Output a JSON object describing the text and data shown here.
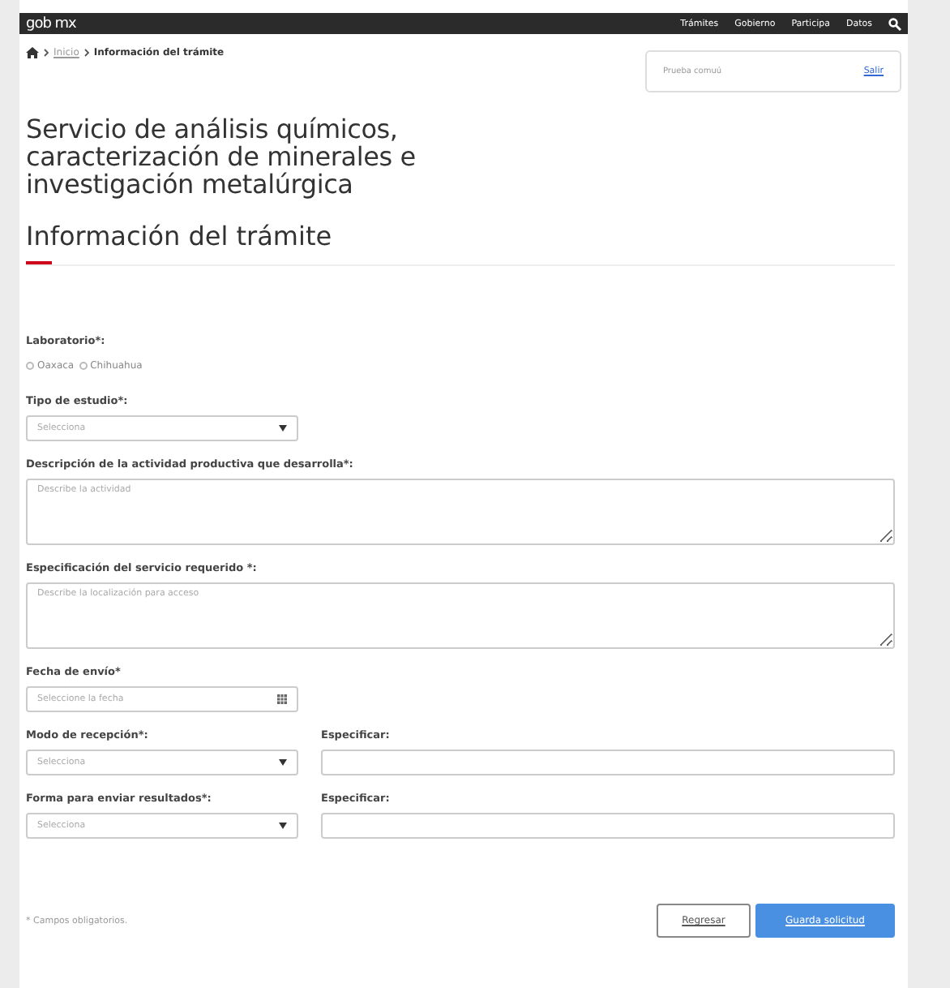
{
  "navbar": {
    "logo": "gob mx",
    "links": [
      "Trámites",
      "Gobierno",
      "Participa",
      "Datos"
    ]
  },
  "breadcrumb": {
    "items": [
      {
        "label": "Inicio",
        "kind": "link"
      },
      {
        "label": "Información del trámite",
        "kind": "current"
      }
    ]
  },
  "user_box": {
    "name": "Prueba comuú",
    "logout": "Salir"
  },
  "title": "Servicio de análisis químicos, caracterización de minerales e investigación metalúrgica",
  "section_title": "Información del trámite",
  "form": {
    "laboratorio": {
      "label": "Laboratorio*:",
      "options": [
        {
          "label": "Oaxaca",
          "selected": false
        },
        {
          "label": "Chihuahua",
          "selected": false
        }
      ]
    },
    "tipo": {
      "label": "Tipo de estudio*:",
      "placeholder": "Selecciona"
    },
    "descripcion": {
      "label": "Descripción de la actividad productiva que desarrolla*:",
      "placeholder": "Describe la actividad"
    },
    "especificacion": {
      "label": "Especificación del servicio requerido *:",
      "placeholder": "Describe la localización para acceso"
    },
    "fecha": {
      "label": "Fecha de envío*",
      "placeholder": "Seleccione la fecha"
    },
    "pairs": [
      {
        "label": "Modo de recepción*:",
        "placeholder": "Selecciona",
        "spec_label": "Especificar:"
      },
      {
        "label": "Forma para enviar resultados*:",
        "placeholder": "Selecciona",
        "spec_label": "Especificar:"
      }
    ]
  },
  "footer": {
    "note": "* Campos obligatorios.",
    "buttons": [
      {
        "label": "Regresar",
        "kind": "secondary"
      },
      {
        "label": "Guarda solicitud",
        "kind": "primary"
      }
    ]
  }
}
